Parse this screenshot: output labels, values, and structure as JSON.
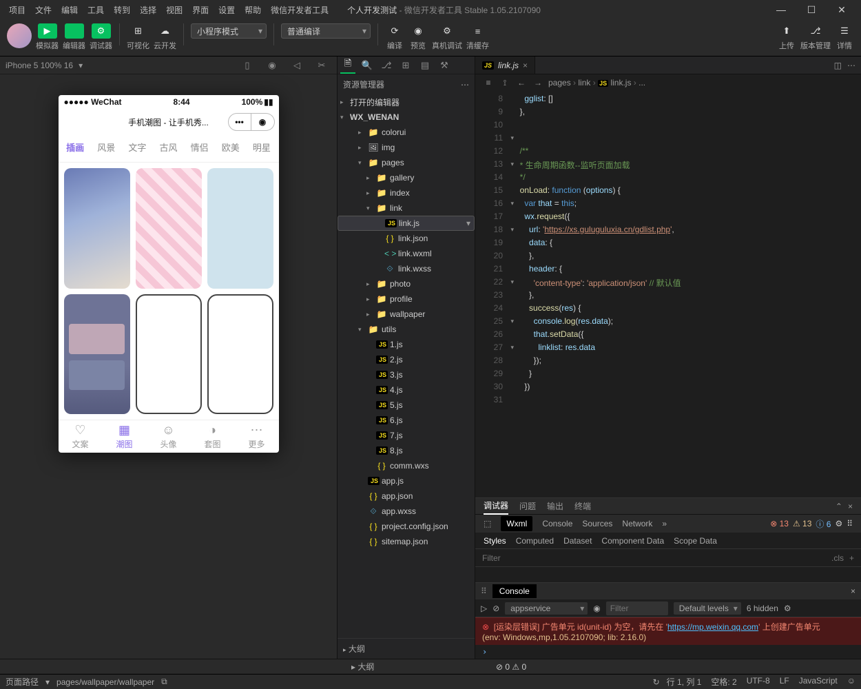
{
  "menubar": [
    "项目",
    "文件",
    "编辑",
    "工具",
    "转到",
    "选择",
    "视图",
    "界面",
    "设置",
    "帮助",
    "微信开发者工具"
  ],
  "title_left": "个人开发测试",
  "title_right": " - 微信开发者工具 Stable 1.05.2107090",
  "toolbar": {
    "mode_btns": [
      {
        "icon": "▶",
        "label": "模拟器"
      },
      {
        "icon": "</>",
        "label": "编辑器"
      },
      {
        "icon": "⚙",
        "label": "调试器"
      }
    ],
    "extra_btns": [
      {
        "icon": "⊞",
        "label": "可视化"
      },
      {
        "icon": "☁",
        "label": "云开发"
      }
    ],
    "miniprogram_mode": "小程序模式",
    "compile_mode": "普通编译",
    "center": [
      {
        "icon": "⟳",
        "label": "编译"
      },
      {
        "icon": "◉",
        "label": "预览"
      },
      {
        "icon": "⚙",
        "label": "真机调试"
      },
      {
        "icon": "≡",
        "label": "清缓存"
      }
    ],
    "right_btns": [
      {
        "icon": "⬆",
        "label": "上传"
      },
      {
        "icon": "⎇",
        "label": "版本管理"
      },
      {
        "icon": "☰",
        "label": "详情"
      }
    ]
  },
  "sim": {
    "device_info": "iPhone 5 100% 16",
    "dropdown": "▾"
  },
  "phone": {
    "carrier": "●●●●● WeChat",
    "wifi": "�ខ",
    "time": "8:44",
    "battery": "100%",
    "title": "手机潮图 - 让手机秀...",
    "cats": [
      "插画",
      "风景",
      "文字",
      "古风",
      "情侣",
      "欧美",
      "明星"
    ],
    "cat_active": 0,
    "tabbar": [
      {
        "icon": "♡",
        "label": "文案"
      },
      {
        "icon": "▦",
        "label": "潮图"
      },
      {
        "icon": "☺",
        "label": "头像"
      },
      {
        "icon": "◑",
        "label": "套图"
      },
      {
        "icon": "⋯",
        "label": "更多"
      }
    ],
    "tab_active": 1
  },
  "explorer": {
    "title": "资源管理器",
    "sections": {
      "open": "打开的编辑器",
      "proj": "WX_WENAN",
      "outline": "大纲"
    },
    "tree": [
      {
        "d": 2,
        "ar": "▸",
        "ic": "fold",
        "t": "colorui"
      },
      {
        "d": 2,
        "ar": "▸",
        "ic": "img",
        "t": "img"
      },
      {
        "d": 2,
        "ar": "▾",
        "ic": "fold",
        "t": "pages"
      },
      {
        "d": 3,
        "ar": "▸",
        "ic": "fold",
        "t": "gallery"
      },
      {
        "d": 3,
        "ar": "▸",
        "ic": "fold",
        "t": "index"
      },
      {
        "d": 3,
        "ar": "▾",
        "ic": "fold",
        "t": "link"
      },
      {
        "d": 4,
        "ar": "",
        "ic": "fjs",
        "t": "link.js",
        "sel": true
      },
      {
        "d": 4,
        "ar": "",
        "ic": "fjson",
        "t": "link.json"
      },
      {
        "d": 4,
        "ar": "",
        "ic": "fwxml",
        "t": "link.wxml"
      },
      {
        "d": 4,
        "ar": "",
        "ic": "fwxss",
        "t": "link.wxss"
      },
      {
        "d": 3,
        "ar": "▸",
        "ic": "fold",
        "t": "photo"
      },
      {
        "d": 3,
        "ar": "▸",
        "ic": "fold",
        "t": "profile"
      },
      {
        "d": 3,
        "ar": "▸",
        "ic": "fold",
        "t": "wallpaper"
      },
      {
        "d": 2,
        "ar": "▾",
        "ic": "futil",
        "t": "utils"
      },
      {
        "d": 3,
        "ar": "",
        "ic": "fjs",
        "t": "1.js"
      },
      {
        "d": 3,
        "ar": "",
        "ic": "fjs",
        "t": "2.js"
      },
      {
        "d": 3,
        "ar": "",
        "ic": "fjs",
        "t": "3.js"
      },
      {
        "d": 3,
        "ar": "",
        "ic": "fjs",
        "t": "4.js"
      },
      {
        "d": 3,
        "ar": "",
        "ic": "fjs",
        "t": "5.js"
      },
      {
        "d": 3,
        "ar": "",
        "ic": "fjs",
        "t": "6.js"
      },
      {
        "d": 3,
        "ar": "",
        "ic": "fjs",
        "t": "7.js"
      },
      {
        "d": 3,
        "ar": "",
        "ic": "fjs",
        "t": "8.js"
      },
      {
        "d": 3,
        "ar": "",
        "ic": "fjson",
        "t": "comm.wxs"
      },
      {
        "d": 2,
        "ar": "",
        "ic": "fjs",
        "t": "app.js"
      },
      {
        "d": 2,
        "ar": "",
        "ic": "fjson",
        "t": "app.json"
      },
      {
        "d": 2,
        "ar": "",
        "ic": "fwxss",
        "t": "app.wxss"
      },
      {
        "d": 2,
        "ar": "",
        "ic": "fjson",
        "t": "project.config.json"
      },
      {
        "d": 2,
        "ar": "",
        "ic": "fjson",
        "t": "sitemap.json"
      }
    ]
  },
  "tab": {
    "file": "link.js",
    "icon": "JS"
  },
  "breadcrumb": [
    "pages",
    "link",
    "link.js",
    "..."
  ],
  "code_start": 8,
  "code_lines": [
    [
      [
        "    ",
        "c-pu"
      ],
      [
        "gglist",
        "c-va"
      ],
      [
        ": []",
        "c-pu"
      ]
    ],
    [
      [
        "  },",
        "c-pu"
      ]
    ],
    [],
    [],
    [
      [
        "  ",
        "c-pu"
      ],
      [
        "/**",
        "c-cm"
      ]
    ],
    [
      [
        "  * 生命周期函数--监听页面加载",
        "c-cm"
      ]
    ],
    [
      [
        "  */",
        "c-cm"
      ]
    ],
    [
      [
        "  ",
        "c-pu"
      ],
      [
        "onLoad",
        "c-fn"
      ],
      [
        ": ",
        "c-pu"
      ],
      [
        "function",
        "c-ky"
      ],
      [
        " (",
        "c-pu"
      ],
      [
        "options",
        "c-va"
      ],
      [
        ") {",
        "c-pu"
      ]
    ],
    [
      [
        "    ",
        "c-pu"
      ],
      [
        "var",
        "c-ky"
      ],
      [
        " ",
        "c-pu"
      ],
      [
        "that",
        "c-va"
      ],
      [
        " = ",
        "c-pu"
      ],
      [
        "this",
        "c-th"
      ],
      [
        ";",
        "c-pu"
      ]
    ],
    [
      [
        "    ",
        "c-pu"
      ],
      [
        "wx",
        "c-va"
      ],
      [
        ".",
        "c-pu"
      ],
      [
        "request",
        "c-fn"
      ],
      [
        "({",
        "c-pu"
      ]
    ],
    [
      [
        "      ",
        "c-pu"
      ],
      [
        "url",
        "c-va"
      ],
      [
        ": ",
        "c-pu"
      ],
      [
        "'",
        "c-st"
      ],
      [
        "https://xs.guluguluxia.cn/gdlist.php",
        "c-st u"
      ],
      [
        "'",
        "c-st"
      ],
      [
        ",",
        "c-pu"
      ]
    ],
    [
      [
        "      ",
        "c-pu"
      ],
      [
        "data",
        "c-va"
      ],
      [
        ": {",
        "c-pu"
      ]
    ],
    [
      [
        "      },",
        "c-pu"
      ]
    ],
    [
      [
        "      ",
        "c-pu"
      ],
      [
        "header",
        "c-va"
      ],
      [
        ": {",
        "c-pu"
      ]
    ],
    [
      [
        "        ",
        "c-pu"
      ],
      [
        "'content-type'",
        "c-st"
      ],
      [
        ": ",
        "c-pu"
      ],
      [
        "'application/json'",
        "c-st"
      ],
      [
        " ",
        "c-pu"
      ],
      [
        "// 默认值",
        "c-cm"
      ]
    ],
    [
      [
        "      },",
        "c-pu"
      ]
    ],
    [
      [
        "      ",
        "c-pu"
      ],
      [
        "success",
        "c-fn"
      ],
      [
        "(",
        "c-pu"
      ],
      [
        "res",
        "c-va"
      ],
      [
        ") {",
        "c-pu"
      ]
    ],
    [
      [
        "        ",
        "c-pu"
      ],
      [
        "console",
        "c-va"
      ],
      [
        ".",
        "c-pu"
      ],
      [
        "log",
        "c-fn"
      ],
      [
        "(",
        "c-pu"
      ],
      [
        "res",
        "c-va"
      ],
      [
        ".",
        "c-pu"
      ],
      [
        "data",
        "c-va"
      ],
      [
        ");",
        "c-pu"
      ]
    ],
    [
      [
        "        ",
        "c-pu"
      ],
      [
        "that",
        "c-va"
      ],
      [
        ".",
        "c-pu"
      ],
      [
        "setData",
        "c-fn"
      ],
      [
        "({",
        "c-pu"
      ]
    ],
    [
      [
        "          ",
        "c-pu"
      ],
      [
        "linklist",
        "c-va"
      ],
      [
        ": ",
        "c-pu"
      ],
      [
        "res",
        "c-va"
      ],
      [
        ".",
        "c-pu"
      ],
      [
        "data",
        "c-va"
      ]
    ],
    [
      [
        "        });",
        "c-pu"
      ]
    ],
    [
      [
        "      }",
        "c-pu"
      ]
    ],
    [
      [
        "    })",
        "c-pu"
      ]
    ],
    []
  ],
  "fold_markers": {
    "3": "▾",
    "5": "▾",
    "8": "▾",
    "10": "▾",
    "14": "▾",
    "17": "▾",
    "19": "▾"
  },
  "debugger": {
    "tabs1": [
      "调试器",
      "问题",
      "输出",
      "终端"
    ],
    "active1": 0,
    "tabs2": [
      "Wxml",
      "Console",
      "Sources",
      "Network"
    ],
    "more": "»",
    "active2": 0,
    "err": "13",
    "warn": "13",
    "info": "6",
    "tabs3": [
      "Styles",
      "Computed",
      "Dataset",
      "Component Data",
      "Scope Data"
    ],
    "active3": 0,
    "filter_ph": "Filter",
    "cls": ".cls",
    "console_title": "Console",
    "ctx": "appservice",
    "filter2_ph": "Filter",
    "levels": "Default levels",
    "hidden": "6 hidden",
    "err_msg": "[运染层错误] 广告单元 id(unit-id) 为空，请先在 '",
    "err_link": "https://mp.weixin.qq.com",
    "err_msg2": "' 上创建广告单元",
    "env": "(env: Windows,mp,1.05.2107090; lib: 2.16.0)",
    "prompt": "›"
  },
  "midbar": {
    "err": "0",
    "warn": "0"
  },
  "status": {
    "path_lbl": "页面路径",
    "path": "pages/wallpaper/wallpaper",
    "ln": "行 1, 列 1",
    "spaces": "空格: 2",
    "enc": "UTF-8",
    "eol": "LF",
    "lang": "JavaScript"
  }
}
